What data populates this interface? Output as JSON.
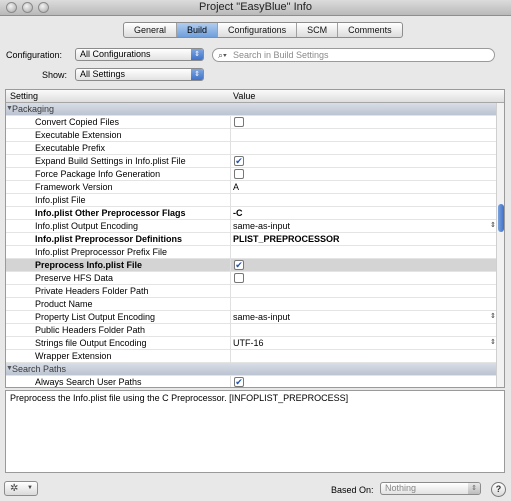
{
  "window": {
    "title": "Project \"EasyBlue\" Info"
  },
  "tabs": [
    {
      "label": "General",
      "active": false
    },
    {
      "label": "Build",
      "active": true
    },
    {
      "label": "Configurations",
      "active": false
    },
    {
      "label": "SCM",
      "active": false
    },
    {
      "label": "Comments",
      "active": false
    }
  ],
  "config": {
    "label": "Configuration:",
    "value": "All Configurations"
  },
  "show": {
    "label": "Show:",
    "value": "All Settings"
  },
  "search": {
    "placeholder": "Search in Build Settings"
  },
  "table": {
    "col_setting": "Setting",
    "col_value": "Value",
    "rows": [
      {
        "type": "section",
        "name": "Packaging"
      },
      {
        "name": "Convert Copied Files",
        "checkbox": true,
        "checked": false
      },
      {
        "name": "Executable Extension"
      },
      {
        "name": "Executable Prefix"
      },
      {
        "name": "Expand Build Settings in Info.plist File",
        "checkbox": true,
        "checked": true
      },
      {
        "name": "Force Package Info Generation",
        "checkbox": true,
        "checked": false
      },
      {
        "name": "Framework Version",
        "value": "A"
      },
      {
        "name": "Info.plist File"
      },
      {
        "name": "Info.plist Other Preprocessor Flags",
        "value": "-C",
        "bold": true
      },
      {
        "name": "Info.plist Output Encoding",
        "value": "same-as-input",
        "popup": true
      },
      {
        "name": "Info.plist Preprocessor Definitions",
        "value": "PLIST_PREPROCESSOR",
        "bold": true
      },
      {
        "name": "Info.plist Preprocessor Prefix File"
      },
      {
        "name": "Preprocess Info.plist File",
        "checkbox": true,
        "checked": true,
        "bold": true,
        "selected": true
      },
      {
        "name": "Preserve HFS Data",
        "checkbox": true,
        "checked": false
      },
      {
        "name": "Private Headers Folder Path"
      },
      {
        "name": "Product Name"
      },
      {
        "name": "Property List Output Encoding",
        "value": "same-as-input",
        "popup": true
      },
      {
        "name": "Public Headers Folder Path"
      },
      {
        "name": "Strings file Output Encoding",
        "value": "UTF-16",
        "popup": true
      },
      {
        "name": "Wrapper Extension"
      },
      {
        "type": "section",
        "name": "Search Paths"
      },
      {
        "name": "Always Search User Paths",
        "checkbox": true,
        "checked": true
      }
    ]
  },
  "description": "Preprocess the Info.plist file using the C Preprocessor. [INFOPLIST_PREPROCESS]",
  "bottom": {
    "based_on_label": "Based On:",
    "based_on_value": "Nothing",
    "help": "?"
  },
  "icons": {
    "gear": "gear-icon",
    "search": "search-icon",
    "help": "help-icon",
    "checkmark": "checkmark-icon"
  }
}
